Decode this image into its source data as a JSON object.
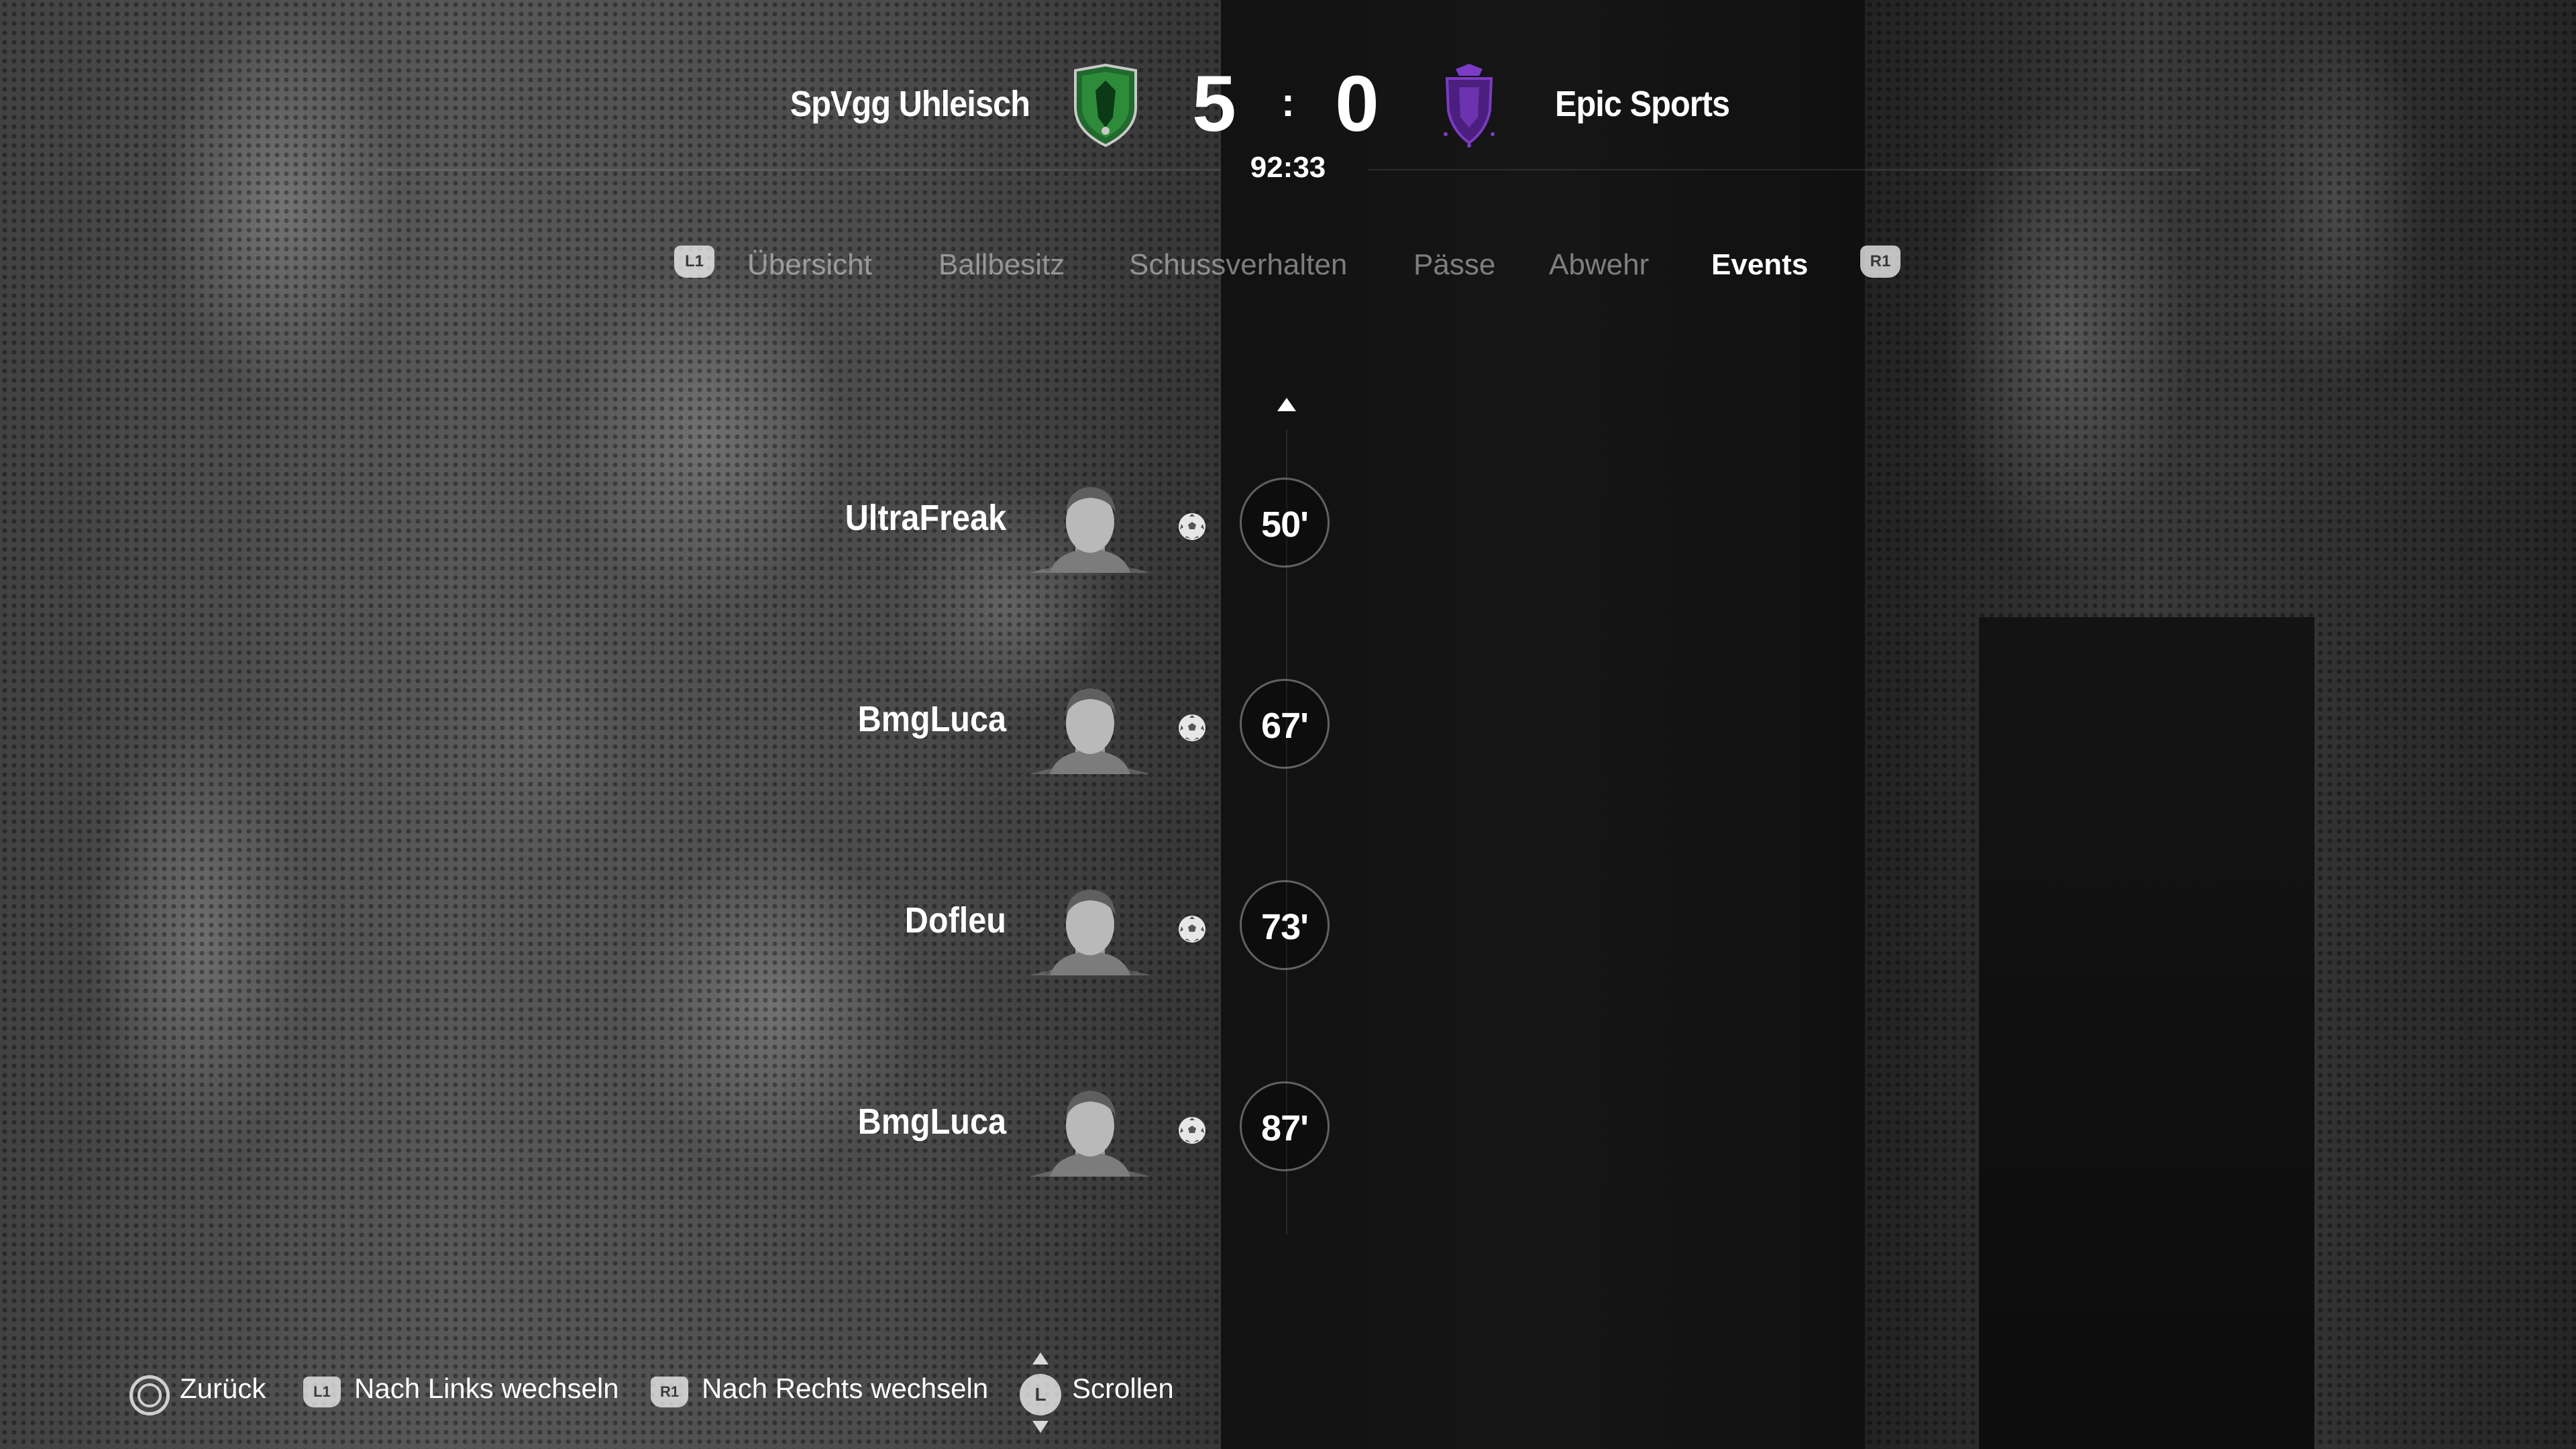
{
  "match": {
    "home_team": "SpVgg Uhleisch",
    "away_team": "Epic Sports",
    "home_score": "5",
    "separator": ":",
    "away_score": "0",
    "clock": "92:33",
    "home_color": "#2e8b3a",
    "away_color": "#7b3bc4"
  },
  "tabs": {
    "left_button": "L1",
    "right_button": "R1",
    "items": [
      {
        "label": "Übersicht"
      },
      {
        "label": "Ballbesitz"
      },
      {
        "label": "Schussverhalten"
      },
      {
        "label": "Pässe"
      },
      {
        "label": "Abwehr"
      },
      {
        "label": "Events",
        "active": true
      }
    ]
  },
  "events": [
    {
      "player": "UltraFreak",
      "minute": "50'",
      "type": "goal",
      "icon": "football-icon"
    },
    {
      "player": "BmgLuca",
      "minute": "67'",
      "type": "goal",
      "icon": "football-icon"
    },
    {
      "player": "Dofleu",
      "minute": "73'",
      "type": "goal",
      "icon": "football-icon"
    },
    {
      "player": "BmgLuca",
      "minute": "87'",
      "type": "goal",
      "icon": "football-icon"
    }
  ],
  "footer": {
    "back_label": "Zurück",
    "l1_badge": "L1",
    "left_label": "Nach Links wechseln",
    "r1_badge": "R1",
    "right_label": "Nach Rechts wechseln",
    "stick_badge": "L",
    "scroll_label": "Scrollen"
  }
}
